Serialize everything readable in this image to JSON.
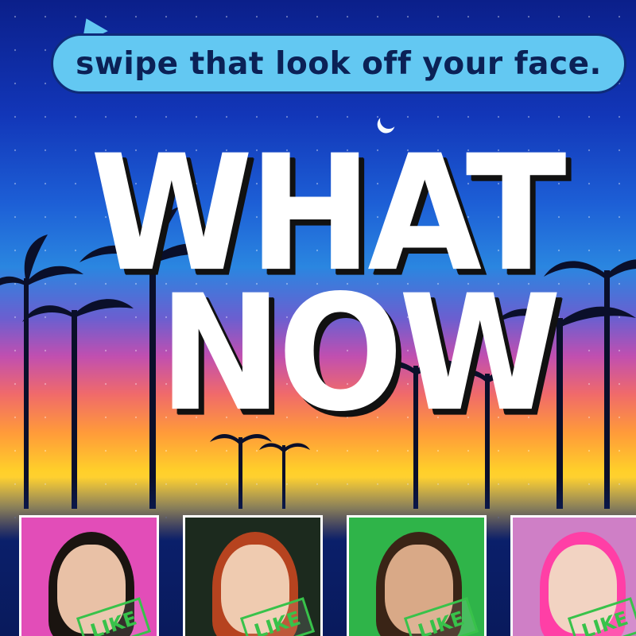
{
  "poster": {
    "tagline": "swipe that look off your face.",
    "title_line_1": "WHAT",
    "title_line_2": "NOW"
  },
  "cards": [
    {
      "stamp": "LIKE",
      "bg": "#e24db8",
      "hair": "#1a1410",
      "skin": "#e9c1a6"
    },
    {
      "stamp": "LIKE",
      "bg": "#1c2a1e",
      "hair": "#b6431f",
      "skin": "#efcbb0"
    },
    {
      "stamp": "LIKE",
      "bg": "#2fb449",
      "hair": "#3a2416",
      "skin": "#d9a987"
    },
    {
      "stamp": "LIKE",
      "bg": "#cf7fc6",
      "hair": "#ff3fa6",
      "skin": "#f2d3c2"
    }
  ],
  "colors": {
    "bubble": "#63c8f2",
    "tagline_text": "#0b2156",
    "title_fill": "#ffffff",
    "title_shadow": "#111111",
    "stamp": "#38c24a"
  }
}
